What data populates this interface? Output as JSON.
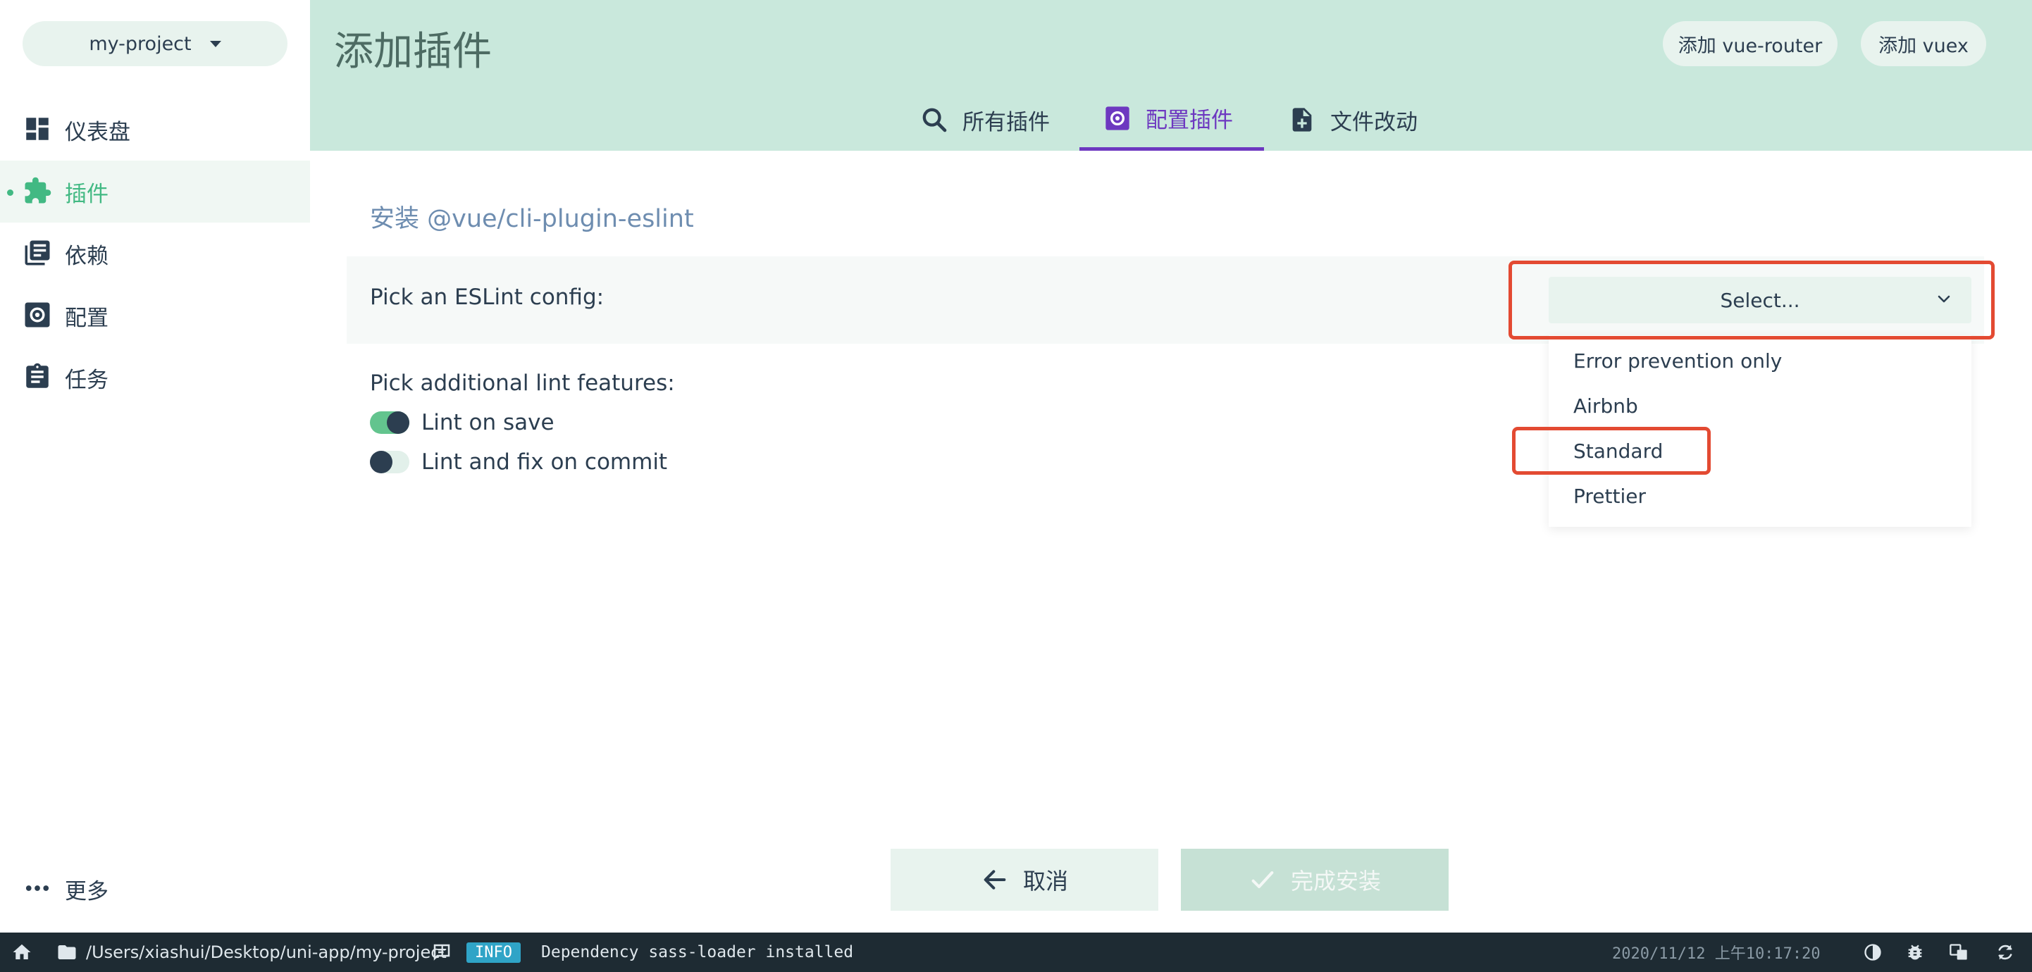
{
  "sidebar": {
    "project": "my-project",
    "items": [
      {
        "label": "仪表盘",
        "icon": "dashboard-icon"
      },
      {
        "label": "插件",
        "icon": "puzzle-icon"
      },
      {
        "label": "依赖",
        "icon": "library-books-icon"
      },
      {
        "label": "配置",
        "icon": "settings-icon"
      },
      {
        "label": "任务",
        "icon": "clipboard-icon"
      }
    ],
    "more": "更多"
  },
  "header": {
    "title": "添加插件",
    "btn_router": "添加 vue-router",
    "btn_vuex": "添加 vuex"
  },
  "tabs": [
    {
      "label": "所有插件",
      "icon": "search-icon"
    },
    {
      "label": "配置插件",
      "icon": "settings-icon"
    },
    {
      "label": "文件改动",
      "icon": "file-add-icon"
    }
  ],
  "main": {
    "install_title": "安装 @vue/cli-plugin-eslint",
    "prompt_label": "Pick an ESLint config:",
    "select_placeholder": "Select...",
    "options": [
      "Error prevention only",
      "Airbnb",
      "Standard",
      "Prettier"
    ],
    "features_label": "Pick additional lint features:",
    "features": [
      {
        "label": "Lint on save",
        "checked": true
      },
      {
        "label": "Lint and fix on commit",
        "checked": false
      }
    ],
    "cancel": "取消",
    "finish": "完成安装"
  },
  "status": {
    "path": "/Users/xiashui/Desktop/uni-app/my-project",
    "level": "INFO",
    "message": "Dependency sass-loader installed",
    "timestamp": "2020/11/12 上午10:17:20"
  },
  "colors": {
    "accent": "#42b983",
    "tab_active": "#6d38c0",
    "header_bg": "#c9e8dc",
    "annotation": "#e34a32"
  }
}
